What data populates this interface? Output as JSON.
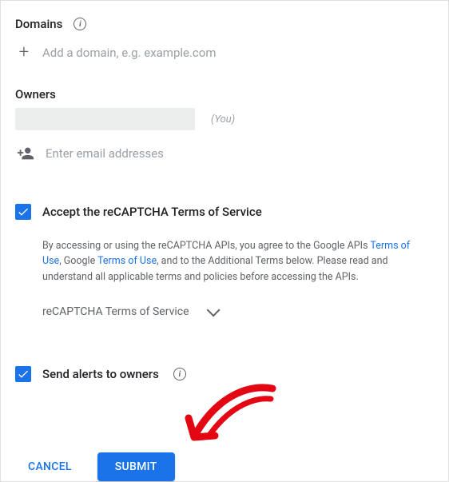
{
  "domains": {
    "title": "Domains",
    "add_placeholder": "Add a domain, e.g. example.com"
  },
  "owners": {
    "title": "Owners",
    "you_label": "(You)",
    "email_placeholder": "Enter email addresses"
  },
  "tos": {
    "checkbox_label": "Accept the reCAPTCHA Terms of Service",
    "desc_lead": "By accessing or using the reCAPTCHA APIs, you agree to the Google APIs ",
    "link1": "Terms of Use",
    "desc_mid1": ", Google ",
    "link2": "Terms of Use",
    "desc_tail": ", and to the Additional Terms below. Please read and understand all applicable terms and policies before accessing the APIs.",
    "expander_label": "reCAPTCHA Terms of Service"
  },
  "alerts": {
    "label": "Send alerts to owners"
  },
  "buttons": {
    "cancel": "CANCEL",
    "submit": "SUBMIT"
  }
}
